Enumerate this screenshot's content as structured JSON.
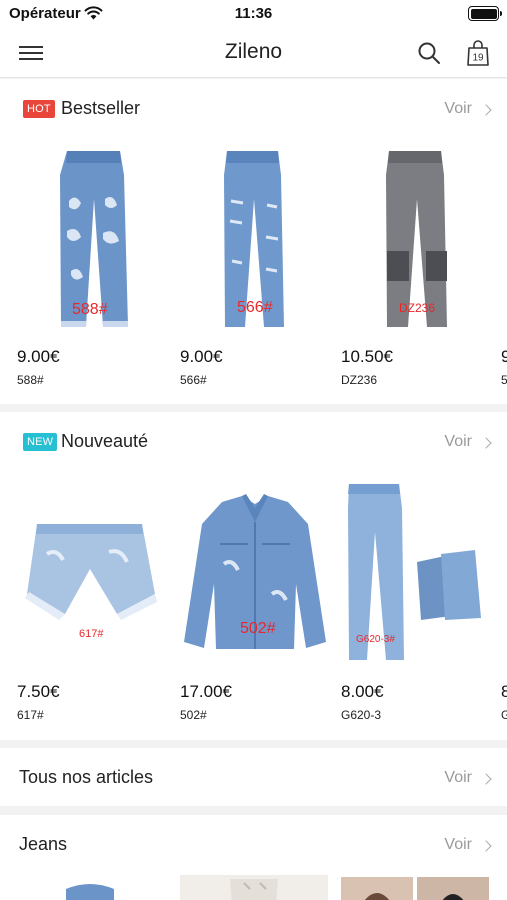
{
  "status": {
    "carrier": "Opérateur",
    "time": "11:36"
  },
  "nav": {
    "title": "Zileno",
    "cart_count": "19"
  },
  "bestseller": {
    "badge": "HOT",
    "title": "Bestseller",
    "more": "Voir",
    "products": [
      {
        "price": "9.00€",
        "ref": "588#",
        "thumb_label": "588#"
      },
      {
        "price": "9.00€",
        "ref": "566#",
        "thumb_label": "566#"
      },
      {
        "price": "10.50€",
        "ref": "DZ236",
        "thumb_label": "DZ236"
      },
      {
        "price": "9",
        "ref": "5"
      }
    ]
  },
  "nouveaute": {
    "badge": "NEW",
    "title": "Nouveauté",
    "more": "Voir",
    "products": [
      {
        "price": "7.50€",
        "ref": "617#",
        "thumb_label": "617#"
      },
      {
        "price": "17.00€",
        "ref": "502#",
        "thumb_label": "502#"
      },
      {
        "price": "8.00€",
        "ref": "G620-3",
        "thumb_label": "G620-3#"
      },
      {
        "price": "8",
        "ref": "G"
      }
    ]
  },
  "all_articles": {
    "title": "Tous nos articles",
    "more": "Voir"
  },
  "jeans": {
    "title": "Jeans",
    "more": "Voir"
  },
  "colors": {
    "hot": "#e8463b",
    "new": "#27c0d3",
    "denim": "#5b87c0",
    "label_red": "#e8282b"
  }
}
